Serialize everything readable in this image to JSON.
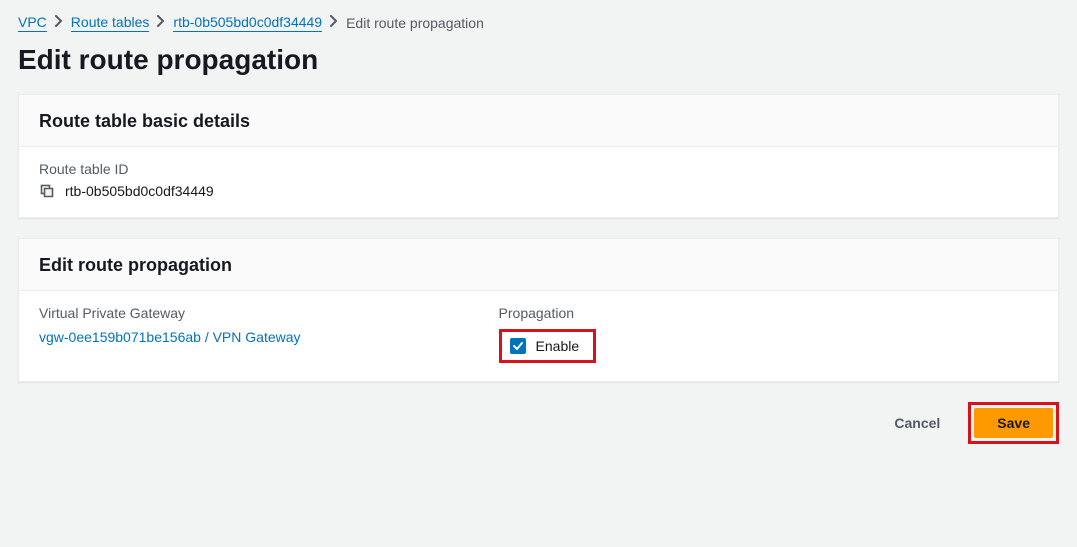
{
  "breadcrumb": {
    "vpc": "VPC",
    "route_tables": "Route tables",
    "rtb_id": "rtb-0b505bd0c0df34449",
    "current": "Edit route propagation"
  },
  "page_title": "Edit route propagation",
  "details_panel": {
    "title": "Route table basic details",
    "route_table_id_label": "Route table ID",
    "route_table_id_value": "rtb-0b505bd0c0df34449"
  },
  "propagation_panel": {
    "title": "Edit route propagation",
    "vgw_header": "Virtual Private Gateway",
    "propagation_header": "Propagation",
    "vgw_link": "vgw-0ee159b071be156ab / VPN Gateway",
    "enable_label": "Enable",
    "enable_checked": true
  },
  "actions": {
    "cancel": "Cancel",
    "save": "Save"
  }
}
